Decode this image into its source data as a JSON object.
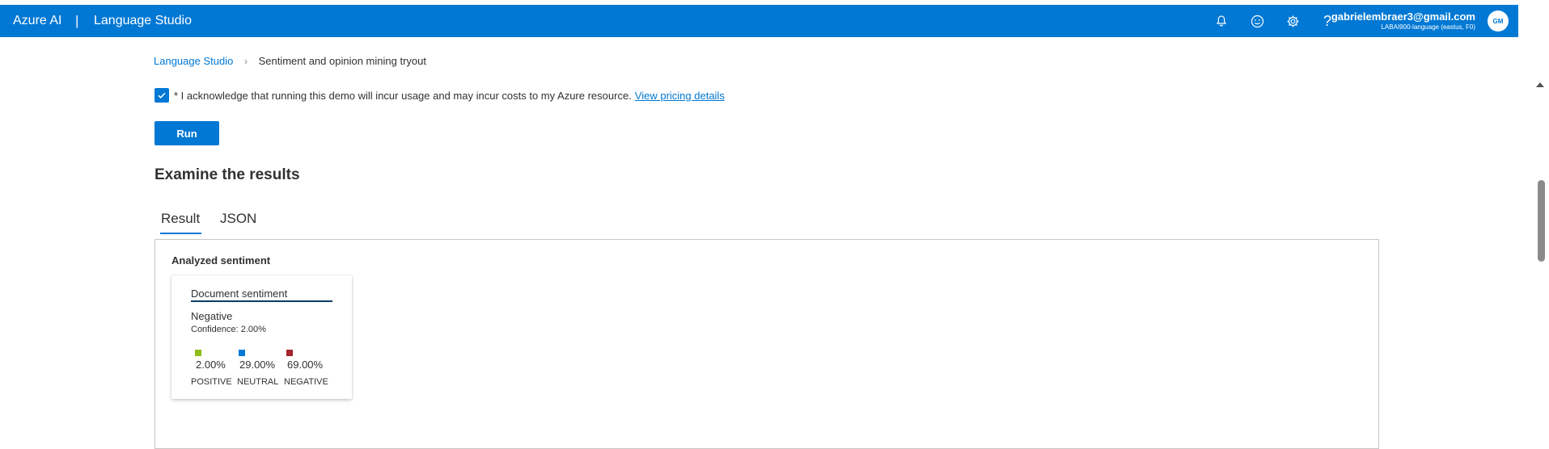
{
  "header": {
    "brand": "Azure AI",
    "separator": "|",
    "product": "Language Studio",
    "icons": [
      "bell-icon",
      "smiley-icon",
      "gear-icon",
      "help-icon"
    ],
    "help_glyph": "?",
    "account_email": "gabrielembraer3@gmail.com",
    "account_resource": "LABAI900-language (eastus, F0)",
    "avatar_initials": "GM"
  },
  "breadcrumb": {
    "home": "Language Studio",
    "current": "Sentiment and opinion mining tryout"
  },
  "acknowledge": {
    "checked": true,
    "text": "* I acknowledge that running this demo will incur usage and may incur costs to my Azure resource.",
    "link": "View pricing details"
  },
  "run_label": "Run",
  "results": {
    "heading": "Examine the results",
    "tabs": [
      "Result",
      "JSON"
    ],
    "active_tab": "Result",
    "panel_title": "Analyzed sentiment",
    "card": {
      "title": "Document sentiment",
      "sentiment": "Negative",
      "confidence": "Confidence: 2.00%",
      "scores": [
        {
          "label": "POSITIVE",
          "value": "2.00%",
          "color": "#8cbd18"
        },
        {
          "label": "NEUTRAL",
          "value": "29.00%",
          "color": "#0078d4"
        },
        {
          "label": "NEGATIVE",
          "value": "69.00%",
          "color": "#a4262c"
        }
      ]
    }
  },
  "colors": {
    "accent": "#0078d4"
  }
}
